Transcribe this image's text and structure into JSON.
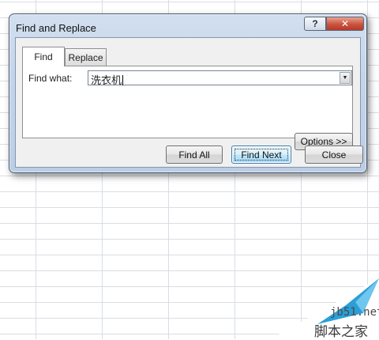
{
  "dialog": {
    "title": "Find and Replace",
    "help_label": "?",
    "close_label": "✕",
    "tabs": [
      {
        "label": "Find",
        "active": true
      },
      {
        "label": "Replace",
        "active": false
      }
    ],
    "find_what_label": "Find what:",
    "find_what_value": "洗衣机",
    "dropdown_arrow": "▼",
    "buttons": {
      "options": "Options >>",
      "find_all": "Find All",
      "find_next": "Find Next",
      "close": "Close"
    }
  },
  "watermark": {
    "site": "jb51.net",
    "brand": "脚本之家"
  },
  "colors": {
    "close_button": "#c9543d",
    "default_button": "#a7d9f5",
    "frame": "#c4d4ea"
  }
}
